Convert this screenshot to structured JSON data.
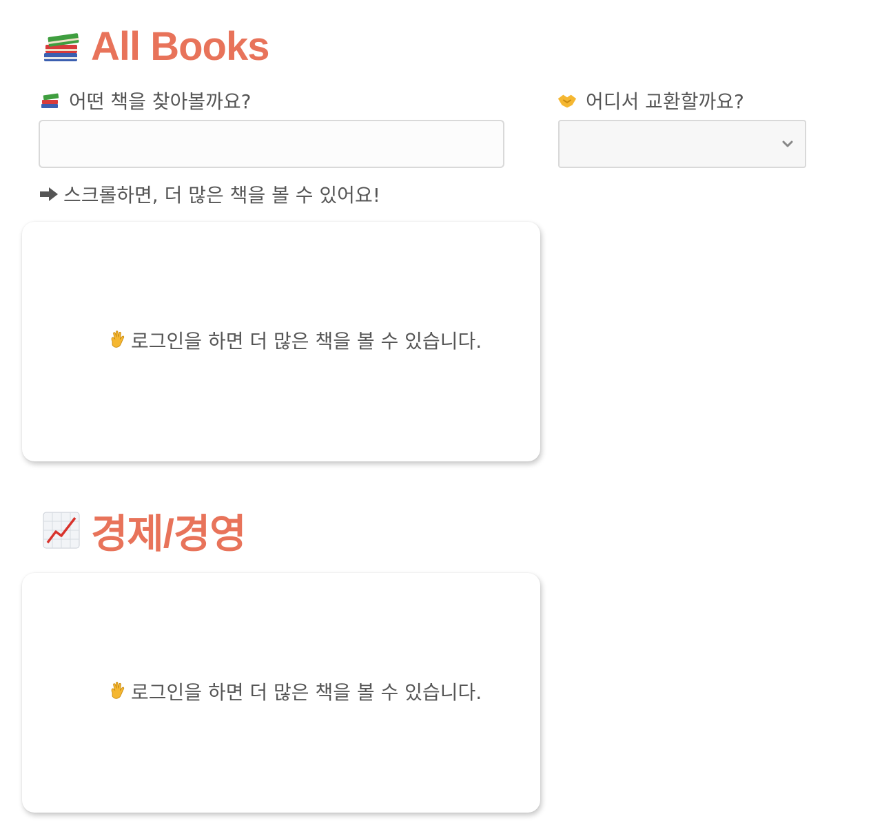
{
  "all_books": {
    "title_icon": "books-icon",
    "title": "All Books"
  },
  "search": {
    "label_icon": "books-icon",
    "label": "어떤 책을 찾아볼까요?",
    "value": "",
    "placeholder": ""
  },
  "location": {
    "label_icon": "handshake-icon",
    "label": "어디서 교환할까요?",
    "selected": ""
  },
  "scroll_hint": {
    "icon": "right-arrow-icon",
    "text": "스크롤하면, 더 많은 책을 볼 수 있어요!"
  },
  "sections": [
    {
      "card_icon": "waving-hand-icon",
      "message": "로그인을 하면 더 많은 책을 볼 수 있습니다."
    },
    {
      "title_icon": "chart-increasing-icon",
      "title": "경제/경영",
      "card_icon": "waving-hand-icon",
      "message": "로그인을 하면 더 많은 책을 볼 수 있습니다."
    }
  ],
  "colors": {
    "accent": "#e8735a",
    "text": "#555555",
    "input_border": "#d9d9d9"
  }
}
